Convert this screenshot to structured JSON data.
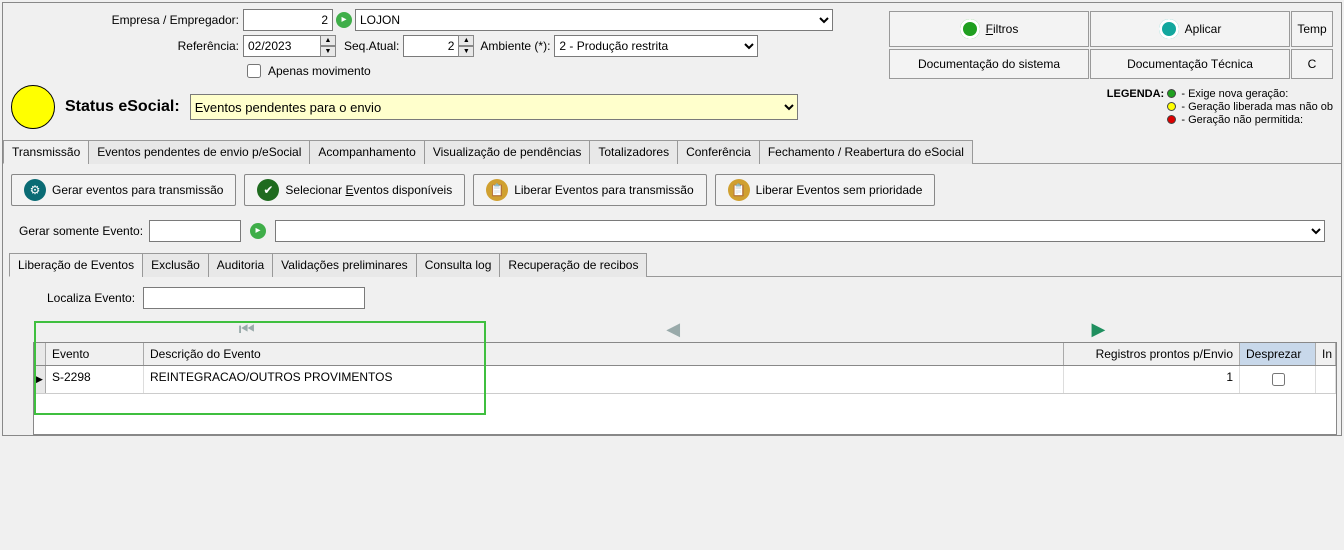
{
  "header": {
    "empresa_label": "Empresa / Empregador:",
    "empresa_id": "2",
    "empresa_nome": "LOJON",
    "referencia_label": "Referência:",
    "referencia_value": "02/2023",
    "seq_atual_label": "Seq.Atual:",
    "seq_atual_value": "2",
    "ambiente_label": "Ambiente (*):",
    "ambiente_value": "2 - Produção restrita",
    "apenas_movimento_label": "Apenas movimento"
  },
  "right_buttons": {
    "filtros": "Filtros",
    "aplicar": "Aplicar",
    "temp": "Temp",
    "doc_sistema": "Documentação do sistema",
    "doc_tecnica": "Documentação Técnica",
    "extra": "C"
  },
  "status": {
    "label": "Status eSocial:",
    "value": "Eventos pendentes para o envio"
  },
  "legend": {
    "title": "LEGENDA:",
    "green": "- Exige nova geração:",
    "yellow": "- Geração liberada mas não ob",
    "red": "- Geração não permitida:"
  },
  "main_tabs": [
    "Transmissão",
    "Eventos pendentes de envio p/eSocial",
    "Acompanhamento",
    "Visualização de pendências",
    "Totalizadores",
    "Conferência",
    "Fechamento / Reabertura do eSocial"
  ],
  "actions": {
    "gerar_eventos": "Gerar eventos para transmissão",
    "selecionar_eventos_pre": "Selecionar ",
    "selecionar_eventos_hot": "E",
    "selecionar_eventos_post": "ventos disponíveis",
    "liberar_transmissao": "Liberar Eventos para transmissão",
    "liberar_sem_prioridade": "Liberar Eventos sem prioridade"
  },
  "gerar_somente": {
    "label": "Gerar somente Evento:",
    "value": ""
  },
  "sub_tabs": [
    "Liberação de Eventos",
    "Exclusão",
    "Auditoria",
    "Validações preliminares",
    "Consulta log",
    "Recuperação de recibos"
  ],
  "localiza": {
    "label": "Localiza Evento:",
    "value": ""
  },
  "grid": {
    "columns": {
      "evento": "Evento",
      "descricao": "Descrição do Evento",
      "registros": "Registros prontos p/Envio",
      "desprezar": "Desprezar",
      "extra": "In"
    },
    "rows": [
      {
        "evento": "S-2298",
        "descricao": "REINTEGRACAO/OUTROS PROVIMENTOS",
        "registros": "1",
        "desprezar": false
      }
    ]
  }
}
